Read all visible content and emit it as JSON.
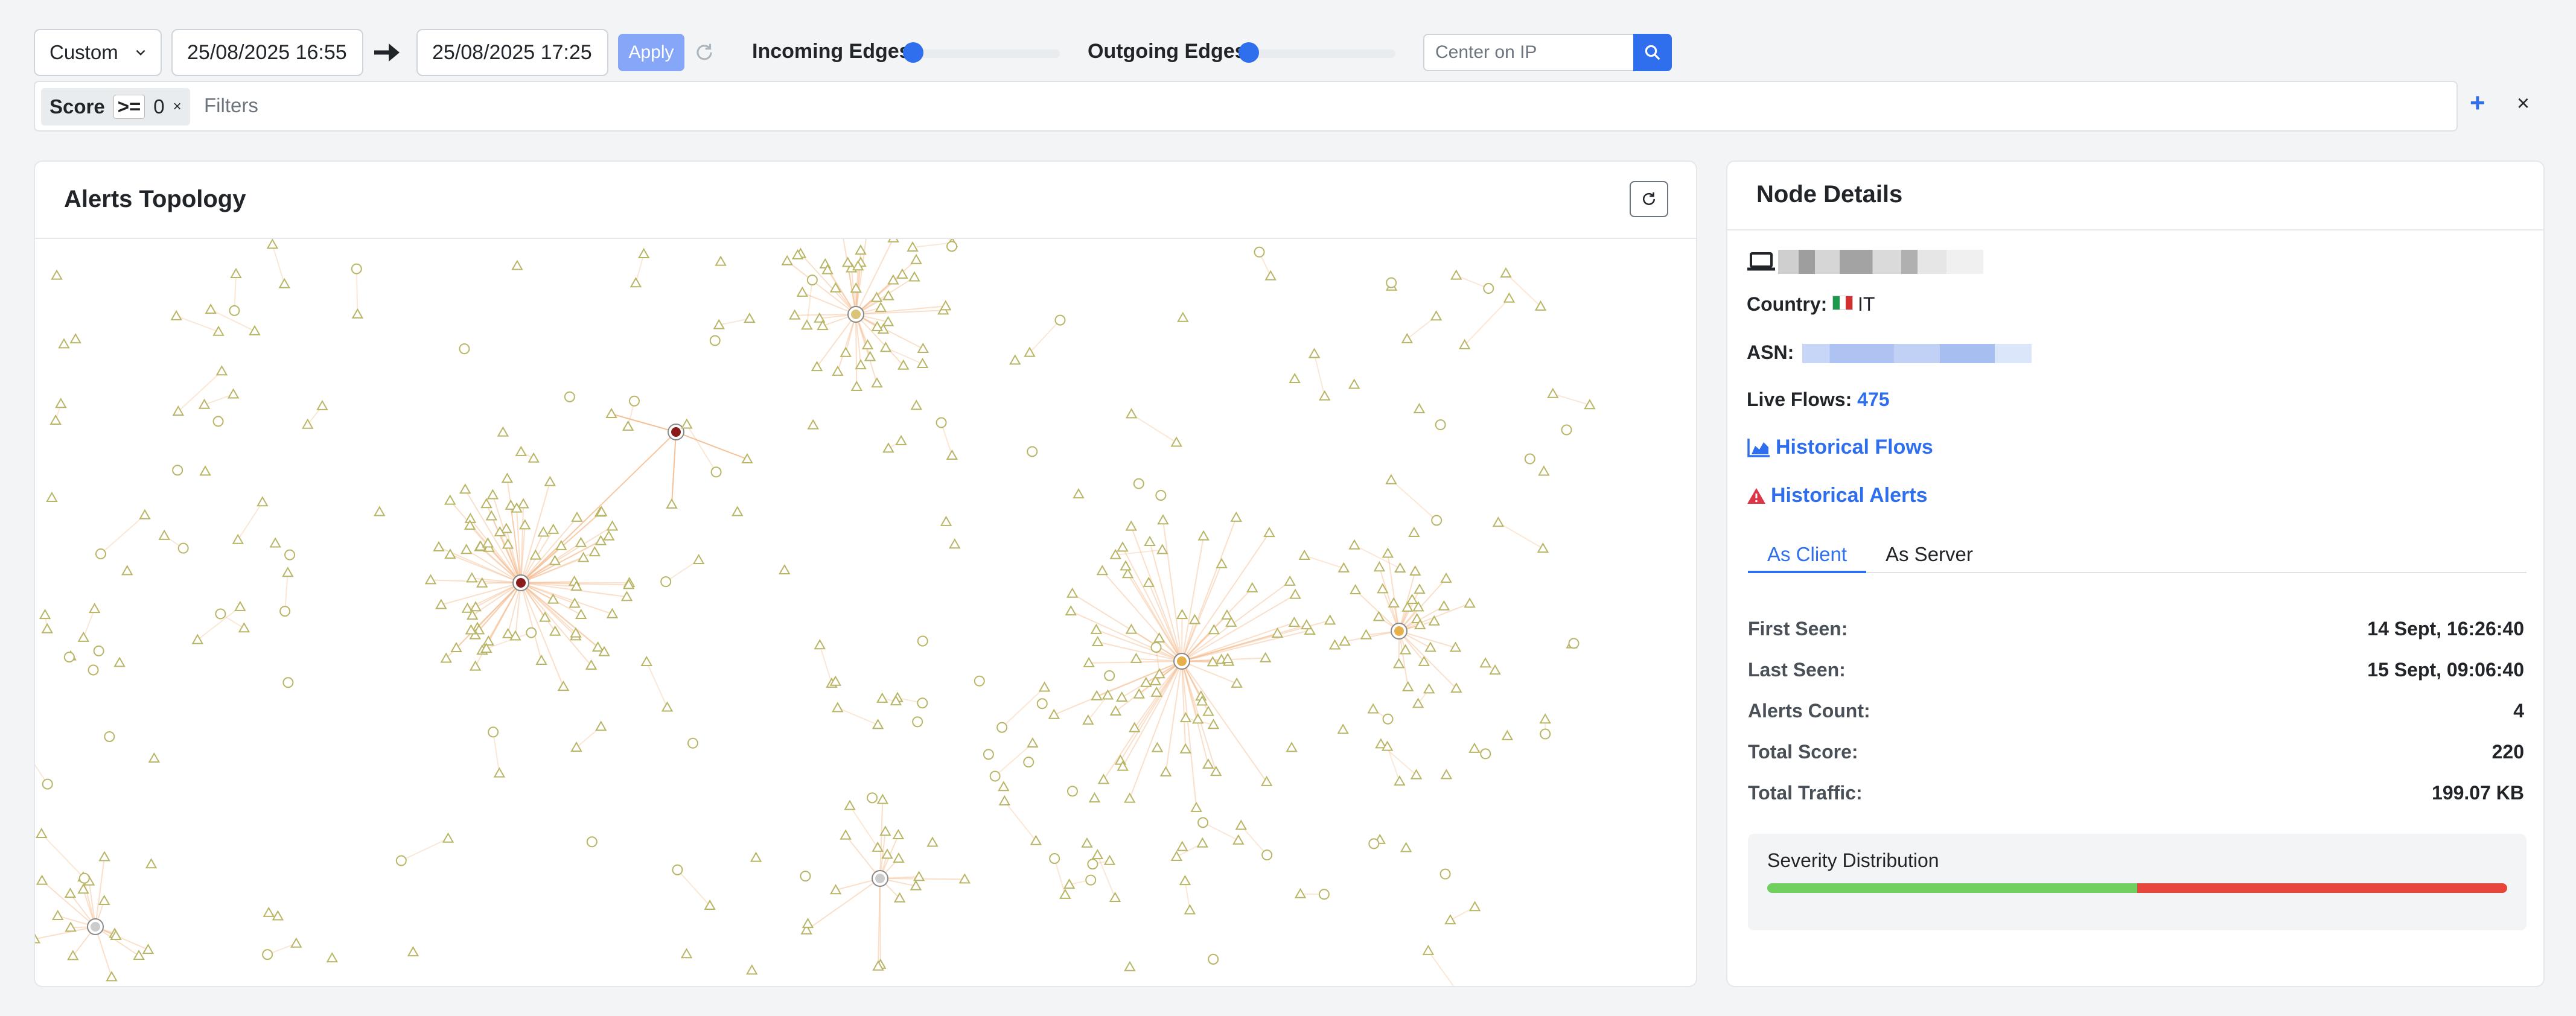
{
  "toolbar": {
    "range_select": "Custom",
    "start_datetime": "25/08/2025 16:55",
    "end_datetime": "25/08/2025 17:25",
    "apply_label": "Apply",
    "incoming_edges_label": "Incoming Edges",
    "incoming_edges_value": 0,
    "outgoing_edges_label": "Outgoing Edges",
    "outgoing_edges_value": 0,
    "center_placeholder": "Center on IP"
  },
  "filters": {
    "chip": {
      "field": "Score",
      "operator": ">=",
      "value": "0",
      "remove": "×"
    },
    "placeholder": "Filters",
    "add": "+",
    "clear": "×"
  },
  "topology": {
    "title": "Alerts Topology"
  },
  "node": {
    "title": "Node Details",
    "country_label": "Country:",
    "country_value": "IT",
    "asn_label": "ASN:",
    "live_flows_label": "Live Flows:",
    "live_flows_value": "475",
    "historical_flows": "Historical Flows",
    "historical_alerts": "Historical Alerts",
    "tabs": [
      {
        "label": "As Client",
        "active": true
      },
      {
        "label": "As Server",
        "active": false
      }
    ],
    "stats": [
      {
        "label": "First Seen:",
        "value": "14 Sept, 16:26:40"
      },
      {
        "label": "Last Seen:",
        "value": "15 Sept, 09:06:40"
      },
      {
        "label": "Alerts Count:",
        "value": "4"
      },
      {
        "label": "Total Score:",
        "value": "220"
      },
      {
        "label": "Total Traffic:",
        "value": "199.07 KB"
      }
    ],
    "severity_title": "Severity Distribution",
    "severity": [
      {
        "level": "low",
        "fraction": 0.5,
        "color": "#6fcf5f"
      },
      {
        "level": "high",
        "fraction": 0.5,
        "color": "#e8453c"
      }
    ]
  },
  "colors": {
    "accent": "#2f6fed",
    "node_stroke": "#b9b566",
    "edge": "#f4b98a",
    "alert_node": "#8b1a1a"
  }
}
